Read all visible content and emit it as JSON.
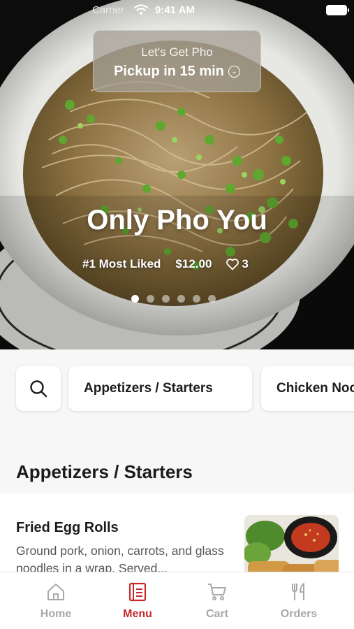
{
  "status_bar": {
    "carrier": "Carrier",
    "time": "9:41 AM"
  },
  "pickup": {
    "title": "Let's Get Pho",
    "subtitle": "Pickup in 15 min",
    "icon": "chevron-circle-icon"
  },
  "featured": {
    "name": "Only Pho You",
    "tag": "#1 Most Liked",
    "price": "$12.00",
    "likes": "3",
    "carousel_pages": 6,
    "carousel_active": 1
  },
  "categories": {
    "search_icon": "search-icon",
    "chips": [
      "Appetizers / Starters",
      "Chicken Noodle Soup"
    ]
  },
  "section": {
    "title": "Appetizers / Starters"
  },
  "item": {
    "name": "Fried Egg Rolls",
    "description": "Ground pork, onion, carrots, and glass noodles in a wrap. Served..."
  },
  "tab_bar": {
    "tabs": [
      {
        "label": "Home",
        "icon": "home-icon"
      },
      {
        "label": "Menu",
        "icon": "menu-icon"
      },
      {
        "label": "Cart",
        "icon": "cart-icon"
      },
      {
        "label": "Orders",
        "icon": "fork-knife-icon"
      }
    ],
    "active": "Menu",
    "active_color": "#c52a2a"
  }
}
